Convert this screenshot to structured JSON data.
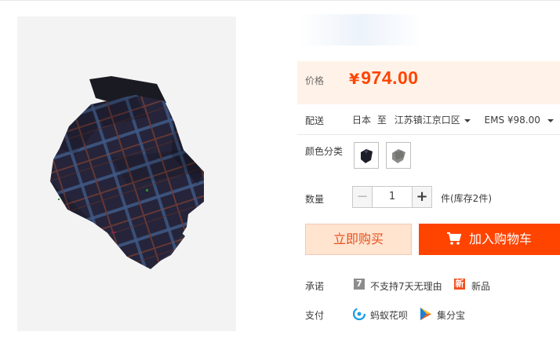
{
  "price": {
    "label": "价格",
    "currency": "¥",
    "value": "974.00"
  },
  "delivery": {
    "label": "配送",
    "from": "日本",
    "to_word": "至",
    "destination": "江苏镇江京口区",
    "shipping": "EMS ¥98.00"
  },
  "color": {
    "label": "颜色分类",
    "options": [
      {
        "name": "dark-scarf-swatch"
      },
      {
        "name": "gray-scarf-swatch"
      }
    ]
  },
  "quantity": {
    "label": "数量",
    "minus": "−",
    "value": "1",
    "plus": "+",
    "stock_text": "件(库存2件)"
  },
  "buttons": {
    "buy_now": "立即购买",
    "add_to_cart": "加入购物车"
  },
  "promise": {
    "label": "承诺",
    "badge_7": "7",
    "no_return": "不支持7天无理由",
    "badge_new": "新",
    "new_item": "新品"
  },
  "payment": {
    "label": "支付",
    "huabei": "蚂蚁花呗",
    "jifenbao": "集分宝"
  },
  "colors": {
    "accent": "#ff4400",
    "price_bg": "#fff2e8",
    "buy_bg": "#ffe4d0"
  }
}
